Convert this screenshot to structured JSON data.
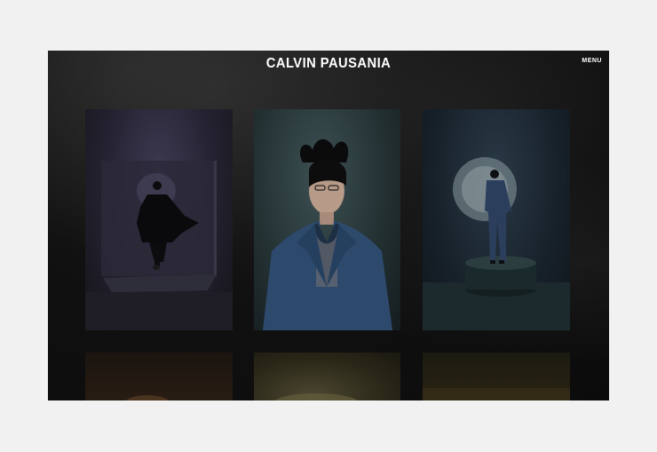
{
  "header": {
    "brand": "CALVIN PAUSANIA",
    "menu_label": "MENU"
  },
  "gallery": {
    "items": [
      {
        "name": "dancer-black-coat-photo"
      },
      {
        "name": "portrait-blue-suit-photo"
      },
      {
        "name": "figure-on-pedestal-photo"
      },
      {
        "name": "warm-toned-photo"
      },
      {
        "name": "olive-toned-photo"
      },
      {
        "name": "dark-gold-photo"
      }
    ]
  },
  "colors": {
    "background": "#0d0d0d",
    "text": "#ffffff",
    "page": "#f1f1f1"
  }
}
